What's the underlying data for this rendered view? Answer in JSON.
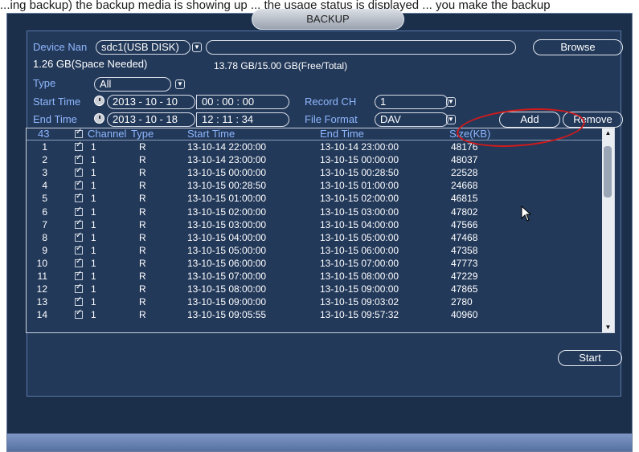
{
  "caption_text": "...ing backup) the backup media is showing up ... the usage status is displayed ... you make the backup",
  "dialog": {
    "title": "BACKUP",
    "device_name_label": "Device Nan",
    "device_name_value": "sdc1(USB DISK)",
    "browse_label": "Browse",
    "space_needed": "1.26 GB(Space Needed)",
    "free_total": "13.78 GB/15.00 GB(Free/Total)",
    "type_label": "Type",
    "type_value": "All",
    "start_time_label": "Start Time",
    "start_date": "2013 - 10 - 10",
    "start_clock": "00 : 00 : 00",
    "end_time_label": "End Time",
    "end_date": "2013 - 10 - 18",
    "end_clock": "12 : 11 : 34",
    "record_ch_label": "Record CH",
    "record_ch_value": "1",
    "file_format_label": "File Format",
    "file_format_value": "DAV",
    "add_label": "Add",
    "remove_label": "Remove",
    "start_label": "Start"
  },
  "table": {
    "count": "43",
    "headers": {
      "channel": "Channel",
      "type": "Type",
      "start": "Start Time",
      "end": "End Time",
      "size": "Size(KB)"
    },
    "rows": [
      {
        "no": "1",
        "ch": "1",
        "type": "R",
        "start": "13-10-14 22:00:00",
        "end": "13-10-14 23:00:00",
        "size": "48176"
      },
      {
        "no": "2",
        "ch": "1",
        "type": "R",
        "start": "13-10-14 23:00:00",
        "end": "13-10-15 00:00:00",
        "size": "48037"
      },
      {
        "no": "3",
        "ch": "1",
        "type": "R",
        "start": "13-10-15 00:00:00",
        "end": "13-10-15 00:28:50",
        "size": "22528"
      },
      {
        "no": "4",
        "ch": "1",
        "type": "R",
        "start": "13-10-15 00:28:50",
        "end": "13-10-15 01:00:00",
        "size": "24668"
      },
      {
        "no": "5",
        "ch": "1",
        "type": "R",
        "start": "13-10-15 01:00:00",
        "end": "13-10-15 02:00:00",
        "size": "46815"
      },
      {
        "no": "6",
        "ch": "1",
        "type": "R",
        "start": "13-10-15 02:00:00",
        "end": "13-10-15 03:00:00",
        "size": "47802"
      },
      {
        "no": "7",
        "ch": "1",
        "type": "R",
        "start": "13-10-15 03:00:00",
        "end": "13-10-15 04:00:00",
        "size": "47566"
      },
      {
        "no": "8",
        "ch": "1",
        "type": "R",
        "start": "13-10-15 04:00:00",
        "end": "13-10-15 05:00:00",
        "size": "47468"
      },
      {
        "no": "9",
        "ch": "1",
        "type": "R",
        "start": "13-10-15 05:00:00",
        "end": "13-10-15 06:00:00",
        "size": "47358"
      },
      {
        "no": "10",
        "ch": "1",
        "type": "R",
        "start": "13-10-15 06:00:00",
        "end": "13-10-15 07:00:00",
        "size": "47773"
      },
      {
        "no": "11",
        "ch": "1",
        "type": "R",
        "start": "13-10-15 07:00:00",
        "end": "13-10-15 08:00:00",
        "size": "47229"
      },
      {
        "no": "12",
        "ch": "1",
        "type": "R",
        "start": "13-10-15 08:00:00",
        "end": "13-10-15 09:00:00",
        "size": "47865"
      },
      {
        "no": "13",
        "ch": "1",
        "type": "R",
        "start": "13-10-15 09:00:00",
        "end": "13-10-15 09:03:02",
        "size": "2780"
      },
      {
        "no": "14",
        "ch": "1",
        "type": "R",
        "start": "13-10-15 09:05:55",
        "end": "13-10-15 09:57:32",
        "size": "40960"
      }
    ]
  },
  "colors": {
    "panel": "#1c2f4a",
    "label": "#8fb7ff",
    "annotation": "#d21a1a"
  }
}
